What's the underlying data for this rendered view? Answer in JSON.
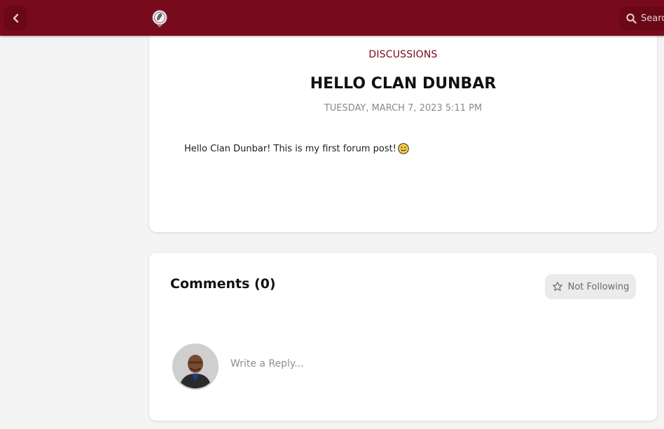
{
  "header": {
    "search_label": "Search",
    "colors": {
      "bar": "#770a1c",
      "button": "#6a0818"
    }
  },
  "post": {
    "category": "DISCUSSIONS",
    "title": "HELLO CLAN DUNBAR",
    "date": "TUESDAY, MARCH 7, 2023 5:11 PM",
    "body": "Hello Clan Dunbar! This is my first forum post!",
    "body_emoji": "slightly-smiling-face"
  },
  "comments": {
    "title": "Comments (0)",
    "follow_label": "Not Following",
    "reply_placeholder": "Write a Reply..."
  }
}
